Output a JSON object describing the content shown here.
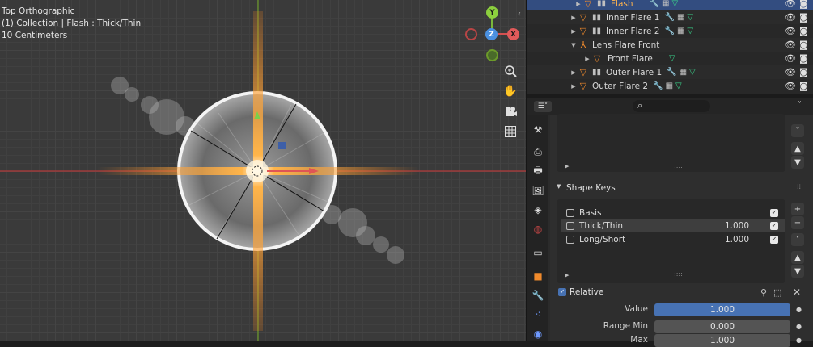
{
  "viewport": {
    "overlay_lines": [
      "Top Orthographic",
      "(1) Collection | Flash : Thick/Thin",
      "10 Centimeters"
    ],
    "gizmo": {
      "y": "Y",
      "x": "X",
      "z": "Z",
      "neg_x": "",
      "neg_y": ""
    },
    "nav_icons": [
      "zoom-icon",
      "hand-icon",
      "camera-icon",
      "grid-icon"
    ]
  },
  "outliner": {
    "items": [
      {
        "label": "Flash",
        "selected": true
      },
      {
        "label": "Inner Flare 1"
      },
      {
        "label": "Inner Flare 2"
      },
      {
        "label": "Lens Flare Front"
      },
      {
        "label": "Front Flare"
      },
      {
        "label": "Outer Flare 1"
      },
      {
        "label": "Outer Flare 2"
      }
    ]
  },
  "properties": {
    "shape_keys_title": "Shape Keys",
    "shape_keys": [
      {
        "name": "Basis",
        "value": "",
        "checked": "✓"
      },
      {
        "name": "Thick/Thin",
        "value": "1.000",
        "checked": "✓"
      },
      {
        "name": "Long/Short",
        "value": "1.000",
        "checked": "✓"
      }
    ],
    "relative_label": "Relative",
    "value_label": "Value",
    "value": "1.000",
    "range_min_label": "Range Min",
    "range_min": "0.000",
    "max_label": "Max",
    "max": "1.000",
    "list_handle": "::::"
  },
  "colors": {
    "accent": "#4772b3",
    "selected_row": "#334d80",
    "object_orange": "#f08a2c",
    "mesh_green": "#39d28a"
  }
}
